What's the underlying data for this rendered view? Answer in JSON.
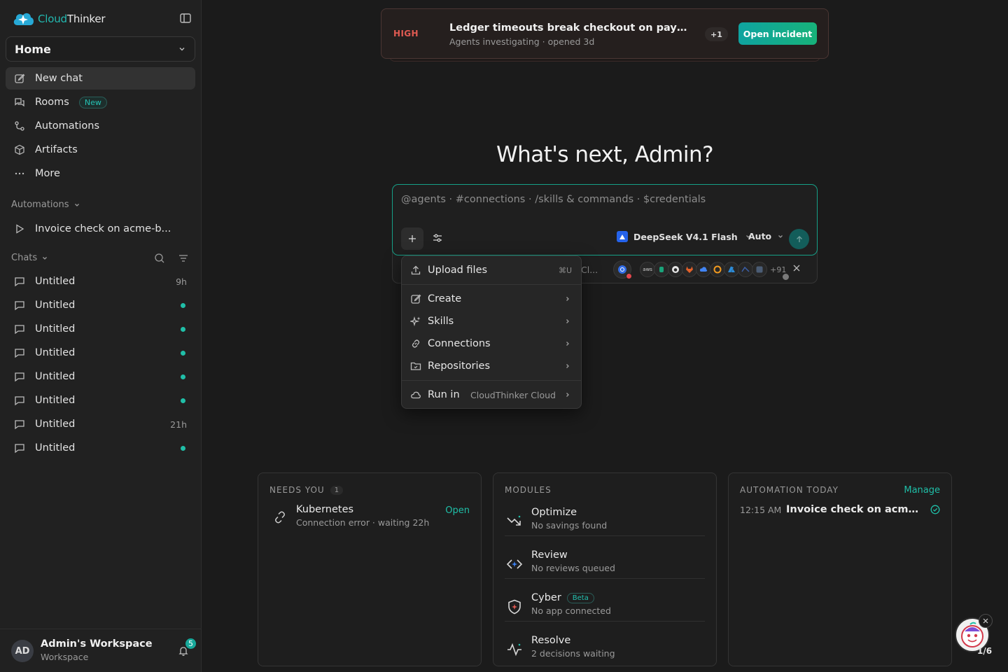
{
  "sidebar": {
    "brand": {
      "part1": "Cloud",
      "part2": "Thinker"
    },
    "workspace_select": "Home",
    "nav": [
      {
        "label": "New chat",
        "icon": "edit-icon"
      },
      {
        "label": "Rooms",
        "icon": "chat-bubbles-icon",
        "badge": "New"
      },
      {
        "label": "Automations",
        "icon": "workflow-icon"
      },
      {
        "label": "Artifacts",
        "icon": "box-icon"
      },
      {
        "label": "More",
        "icon": "ellipsis-icon"
      }
    ],
    "automations_heading": "Automations",
    "automations": [
      {
        "label": "Invoice check on acme-b..."
      }
    ],
    "chats_heading": "Chats",
    "chats": [
      {
        "label": "Untitled",
        "meta": "9h"
      },
      {
        "label": "Untitled",
        "unread": true
      },
      {
        "label": "Untitled",
        "unread": true
      },
      {
        "label": "Untitled",
        "unread": true
      },
      {
        "label": "Untitled",
        "unread": true
      },
      {
        "label": "Untitled",
        "unread": true
      },
      {
        "label": "Untitled",
        "meta": "21h"
      },
      {
        "label": "Untitled",
        "unread": true
      }
    ],
    "footer": {
      "initials": "AD",
      "workspace_name": "Admin's Workspace",
      "workspace_type": "Workspace",
      "notifications": "5"
    }
  },
  "incident": {
    "severity": "HIGH",
    "title": "Ledger timeouts break checkout on payment...",
    "subtitle": "Agents investigating · opened 3d",
    "extra_count": "+1",
    "action": "Open incident"
  },
  "greeting": "What's next, Admin?",
  "composer": {
    "placeholder": "@agents · #connections · /skills & commands · $credentials",
    "model": "DeepSeek V4.1 Flash",
    "mode": "Auto",
    "connections_truncated": "Cl...",
    "connections_more": "+91"
  },
  "menu": {
    "upload": {
      "label": "Upload files",
      "shortcut": "⌘U"
    },
    "items": [
      {
        "label": "Create"
      },
      {
        "label": "Skills"
      },
      {
        "label": "Connections"
      },
      {
        "label": "Repositories"
      }
    ],
    "run_in": {
      "label": "Run in",
      "value": "CloudThinker Cloud"
    }
  },
  "cards": {
    "needs_you": {
      "title": "NEEDS YOU",
      "count": "1",
      "item": {
        "title": "Kubernetes",
        "subtitle": "Connection error · waiting 22h",
        "action": "Open"
      }
    },
    "modules": {
      "title": "MODULES",
      "items": [
        {
          "title": "Optimize",
          "subtitle": "No savings found"
        },
        {
          "title": "Review",
          "subtitle": "No reviews queued"
        },
        {
          "title": "Cyber",
          "subtitle": "No app connected",
          "badge": "Beta"
        },
        {
          "title": "Resolve",
          "subtitle": "2 decisions waiting"
        }
      ]
    },
    "automation_today": {
      "title": "AUTOMATION TODAY",
      "action": "Manage",
      "item": {
        "time": "12:15 AM",
        "name": "Invoice check on acme-b..."
      }
    }
  },
  "helper": {
    "progress": "1/6"
  },
  "colors": {
    "accent": "#1fbfa8",
    "danger": "#e05a52",
    "background": "#1b1b1b",
    "sidebar": "#212121"
  }
}
